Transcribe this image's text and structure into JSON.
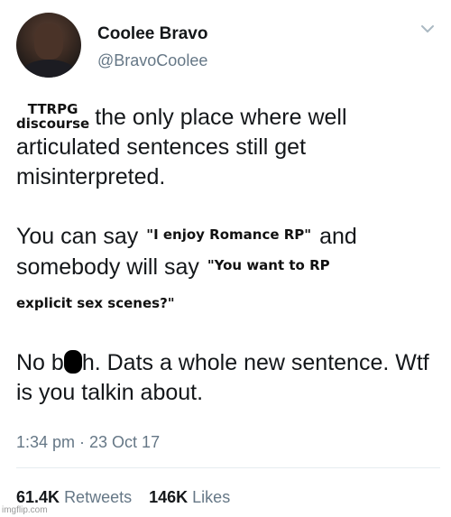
{
  "author": {
    "name": "Coolee Bravo",
    "handle": "@BravoCoolee"
  },
  "icons": {
    "more": "chevron-down-icon",
    "avatar": "profile-photo"
  },
  "tweet": {
    "sticker_ttrpg_line1": "TTRPG",
    "sticker_ttrpg_line2": "discourse",
    "line1": "the only place where well articulated sentences still get misinterpreted.",
    "p2_prefix": "You can say",
    "sticker_romance": "\"I enjoy Romance RP\"",
    "p2_mid": "and somebody will say",
    "sticker_explicit_1": "\"You want to RP",
    "sticker_explicit_2": "explicit sex scenes?\"",
    "p3_start": "No b",
    "p3_rest": "h. Dats a whole new sentence. Wtf is you talkin about."
  },
  "timestamp": "1:34 pm · 23 Oct 17",
  "stats": {
    "retweets_count": "61.4K",
    "retweets_label": "Retweets",
    "likes_count": "146K",
    "likes_label": "Likes"
  },
  "watermark": "imgflip.com"
}
